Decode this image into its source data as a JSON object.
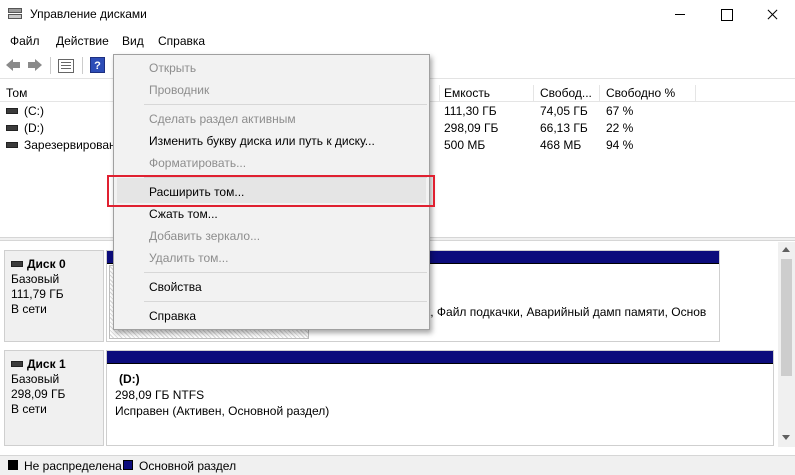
{
  "window": {
    "title": "Управление дисками"
  },
  "menubar": [
    "Файл",
    "Действие",
    "Вид",
    "Справка"
  ],
  "volume_table": {
    "columns": [
      "Том",
      "Емкость",
      "Свобод...",
      "Свободно %"
    ],
    "rows": [
      {
        "name": "(C:)",
        "capacity": "111,30 ГБ",
        "free": "74,05 ГБ",
        "free_pct": "67 %"
      },
      {
        "name": "(D:)",
        "capacity": "298,09 ГБ",
        "free": "66,13 ГБ",
        "free_pct": "22 %"
      },
      {
        "name": "Зарезервировано",
        "capacity": "500 МБ",
        "free": "468 МБ",
        "free_pct": "94 %"
      }
    ]
  },
  "disks": [
    {
      "name": "Диск 0",
      "type": "Базовый",
      "size": "111,79 ГБ",
      "status": "В сети",
      "partition_text": "к, Файл подкачки, Аварийный дамп памяти, Основ"
    },
    {
      "name": "Диск 1",
      "type": "Базовый",
      "size": "298,09 ГБ",
      "status": "В сети",
      "partition": {
        "label": "(D:)",
        "size_fs": "298,09 ГБ NTFS",
        "status": "Исправен (Активен, Основной раздел)"
      }
    }
  ],
  "legend": {
    "unallocated": "Не распределена",
    "primary": "Основной раздел",
    "unallocated_color": "#000000",
    "primary_color": "#0c0c7c"
  },
  "context_menu": {
    "items": [
      {
        "label": "Открыть",
        "enabled": false
      },
      {
        "label": "Проводник",
        "enabled": false
      },
      {
        "label": "Сделать раздел активным",
        "enabled": false
      },
      {
        "label": "Изменить букву диска или путь к диску...",
        "enabled": true
      },
      {
        "label": "Форматировать...",
        "enabled": false
      },
      {
        "label": "Расширить том...",
        "enabled": true,
        "highlighted": true
      },
      {
        "label": "Сжать том...",
        "enabled": true
      },
      {
        "label": "Добавить зеркало...",
        "enabled": false
      },
      {
        "label": "Удалить том...",
        "enabled": false
      },
      {
        "label": "Свойства",
        "enabled": true
      },
      {
        "label": "Справка",
        "enabled": true
      }
    ]
  },
  "colors": {
    "highlight_border": "#e02030",
    "partition_bar": "#0c0c7c"
  }
}
